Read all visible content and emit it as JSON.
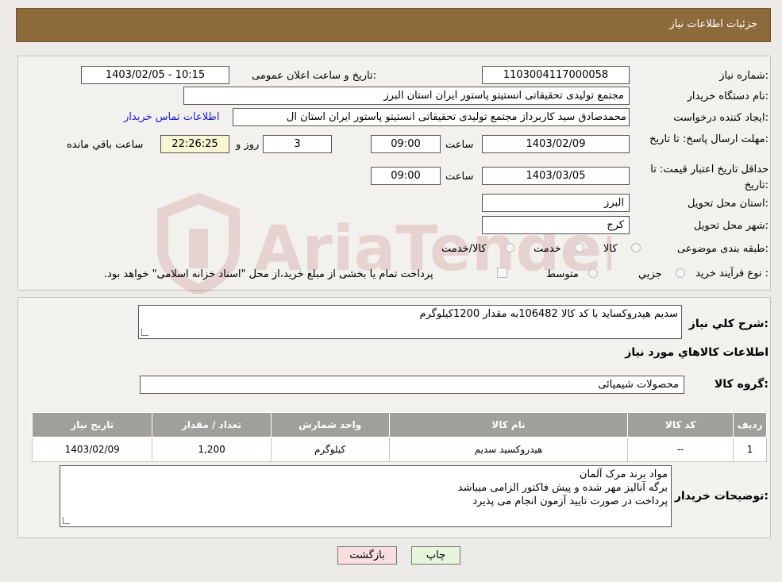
{
  "header": {
    "title": "جزئیات اطلاعات نیاز"
  },
  "form": {
    "need_number": {
      "label": "شماره نیاز:",
      "value": "1103004117000058"
    },
    "announce": {
      "label": "تاریخ و ساعت اعلان عمومی:",
      "value": "1403/02/05 - 10:15"
    },
    "buyer_org": {
      "label": "نام دستگاه خریدار:",
      "value": "مجتمع تولیدی تحقیقاتی انستیتو پاستور ایران استان البرز"
    },
    "requester": {
      "label": "ایجاد کننده درخواست:",
      "value": "محمدصادق سید کاربرداز مجتمع تولیدی تحقیقاتی انستیتو پاستور ایران استان ال",
      "contact_link": "اطلاعات تماس خریدار"
    },
    "reply_deadline": {
      "label": "مهلت ارسال پاسخ: تا تاریخ:",
      "date": "1403/02/09",
      "time_label": "ساعت",
      "time": "09:00",
      "days": "3",
      "days_label": "روز و",
      "remaining": "22:26:25",
      "remaining_label": "ساعت باقي مانده"
    },
    "price_validity": {
      "label": "حداقل تاریخ اعتبار قیمت: تا تاریخ:",
      "date": "1403/03/05",
      "time_label": "ساعت",
      "time": "09:00"
    },
    "province": {
      "label": "استان محل تحویل:",
      "value": "البرز"
    },
    "city": {
      "label": "شهر محل تحویل:",
      "value": "کرج"
    },
    "category": {
      "label": "طبقه بندی موضوعی:",
      "options": [
        "کالا",
        "خدمت",
        "کالا/خدمت"
      ]
    },
    "purchase_type": {
      "label": "نوع فرآیند خرید :",
      "options": [
        "جزیي",
        "متوسط"
      ],
      "note": "پرداخت تمام یا بخشی از مبلغ خرید،از محل \"اسناد خزانه اسلامی\" خواهد بود."
    }
  },
  "watermark": {
    "text": "AriaTender.neT"
  },
  "details": {
    "summary_label": "شرح کلي نياز:",
    "summary_value": "سدیم هیدروکساید با کد کالا 106482به مقدار 1200کیلوگرم",
    "goods_title": "اطلاعات کالاهاي مورد نياز",
    "group_label": "گروه کالا:",
    "group_value": "محصولات شیمیائی",
    "table": {
      "headers": [
        "رديف",
        "کد کالا",
        "نام کالا",
        "واحد شمارش",
        "تعداد / مقدار",
        "تاريخ نياز"
      ],
      "rows": [
        [
          "1",
          "--",
          "هیدروکسید سدیم",
          "کیلوگرم",
          "1,200",
          "1403/02/09"
        ]
      ]
    },
    "buyer_notes_label": "توضيحات خريدار:",
    "buyer_notes": [
      "مواد برند مرک آلمان",
      "برگه آنالیز مهر شده و پیش فاکتور الزامی میباشد",
      "پرداخت در صورت تایید آزمون انجام می پذیرد"
    ]
  },
  "buttons": {
    "print": "چاپ",
    "back": "بازگشت"
  },
  "colors": {
    "header": "#8c6a3c",
    "link": "#1c1ce0",
    "table_header": "#a09f9b",
    "back_button": "#f8dede",
    "print_button": "#e6f5dc"
  }
}
